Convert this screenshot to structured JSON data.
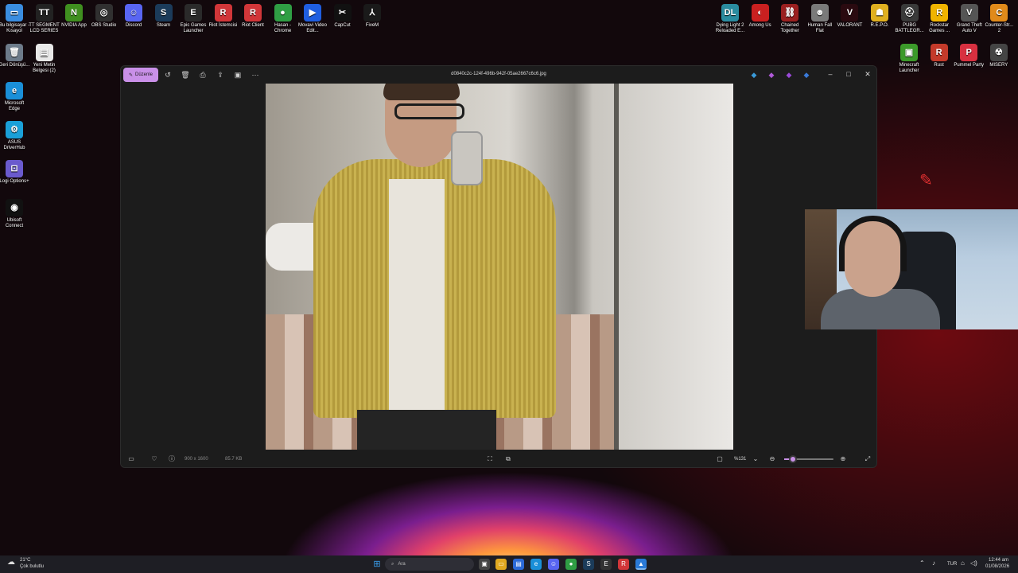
{
  "desktop_left": [
    {
      "label": "Bu bilgisayar - Kısayol",
      "icon": "computer-icon",
      "color": "#3a8de0",
      "glyph": "▭"
    },
    {
      "label": "TT SEGMENT LCD SERIES",
      "icon": "tt-icon",
      "color": "#222222",
      "glyph": "TT"
    },
    {
      "label": "NVIDIA App",
      "icon": "nvidia-icon",
      "color": "#3f8f1f",
      "glyph": "N"
    },
    {
      "label": "OBS Studio",
      "icon": "obs-icon",
      "color": "#303030",
      "glyph": "◎"
    },
    {
      "label": "Discord",
      "icon": "discord-icon",
      "color": "#5865f2",
      "glyph": "☺"
    },
    {
      "label": "Steam",
      "icon": "steam-icon",
      "color": "#1b3b5a",
      "glyph": "S"
    },
    {
      "label": "Epic Games Launcher",
      "icon": "epic-icon",
      "color": "#2a2a2a",
      "glyph": "E"
    },
    {
      "label": "Riot İstemcisi",
      "icon": "riot-client-icon",
      "color": "#d13639",
      "glyph": "R"
    },
    {
      "label": "Riot Client",
      "icon": "riot-icon",
      "color": "#d13639",
      "glyph": "R"
    },
    {
      "label": "Hasan - Chrome",
      "icon": "chrome-icon",
      "color": "#2f9e44",
      "glyph": "●"
    },
    {
      "label": "Movavi Video Edit...",
      "icon": "movavi-icon",
      "color": "#1f5ee0",
      "glyph": "▶"
    },
    {
      "label": "CapCut",
      "icon": "capcut-icon",
      "color": "#111111",
      "glyph": "✂"
    },
    {
      "label": "FiveM",
      "icon": "fivem-icon",
      "color": "#1a1a1a",
      "glyph": "⅄"
    }
  ],
  "desktop_left_col": [
    {
      "label": "Geri Dönüşü...",
      "icon": "recycle-bin-icon",
      "color": "#6d7b8a",
      "glyph": "🗑"
    },
    {
      "label": "Yeni Metin Belgesi (2)",
      "icon": "text-document-icon",
      "color": "#e8e8e8",
      "glyph": "▤"
    }
  ],
  "desktop_left_col2": [
    {
      "label": "Microsoft Edge",
      "icon": "edge-icon",
      "color": "#1a8fd8",
      "glyph": "e"
    },
    {
      "label": "ASUS DriverHub",
      "icon": "asus-icon",
      "color": "#1aa0d8",
      "glyph": "⚙"
    },
    {
      "label": "Logi Options+",
      "icon": "logi-icon",
      "color": "#6a5acd",
      "glyph": "⊡"
    },
    {
      "label": "Ubisoft Connect",
      "icon": "ubisoft-icon",
      "color": "#111111",
      "glyph": "◉"
    }
  ],
  "desktop_right": [
    {
      "label": "Dying Light 2 Reloaded E...",
      "icon": "dying-light-icon",
      "color": "#2a8ca0",
      "glyph": "DL"
    },
    {
      "label": "Among Us",
      "icon": "among-us-icon",
      "color": "#c92020",
      "glyph": "◐"
    },
    {
      "label": "Chained Together",
      "icon": "chained-together-icon",
      "color": "#9a2020",
      "glyph": "⛓"
    },
    {
      "label": "Human Fall Flat",
      "icon": "human-fall-flat-icon",
      "color": "#7a7a7a",
      "glyph": "☻"
    },
    {
      "label": "VALORANT",
      "icon": "valorant-icon",
      "color": "#2a0a10",
      "glyph": "V"
    },
    {
      "label": "R.E.P.O.",
      "icon": "repo-icon",
      "color": "#e0b020",
      "glyph": "☗"
    },
    {
      "label": "PUBG BATTLEGR...",
      "icon": "pubg-icon",
      "color": "#3a3a3a",
      "glyph": "⛑"
    },
    {
      "label": "Rockstar Games ...",
      "icon": "rockstar-icon",
      "color": "#f0b400",
      "glyph": "R"
    },
    {
      "label": "Grand Theft Auto V",
      "icon": "gta-icon",
      "color": "#555555",
      "glyph": "V"
    },
    {
      "label": "Counter-Str... 2",
      "icon": "cs2-icon",
      "color": "#e08a1a",
      "glyph": "C"
    }
  ],
  "desktop_right_row2": [
    {
      "label": "Minecraft Launcher",
      "icon": "minecraft-icon",
      "color": "#3c9a2a",
      "glyph": "▣"
    },
    {
      "label": "Rust",
      "icon": "rust-icon",
      "color": "#c43a2a",
      "glyph": "R"
    },
    {
      "label": "Pummel Party",
      "icon": "pummel-party-icon",
      "color": "#d83040",
      "glyph": "P"
    },
    {
      "label": "MISERY",
      "icon": "misery-icon",
      "color": "#444444",
      "glyph": "☢"
    }
  ],
  "viewer": {
    "edit_label": "Düzenle",
    "file_name": "d0840c2c-124f-496b-942f-05ae2667c6c6.jpg",
    "dimensions": "900 x 1600",
    "file_size": "85.7 KB",
    "zoom_label": "%131",
    "zoom_fraction": 0.18
  },
  "taskbar": {
    "weather_temp": "21°C",
    "weather_desc": "Çok bulutlu",
    "search_placeholder": "Ara",
    "language": "TUR",
    "time": "12:44 am",
    "date": "01/08/2026"
  }
}
